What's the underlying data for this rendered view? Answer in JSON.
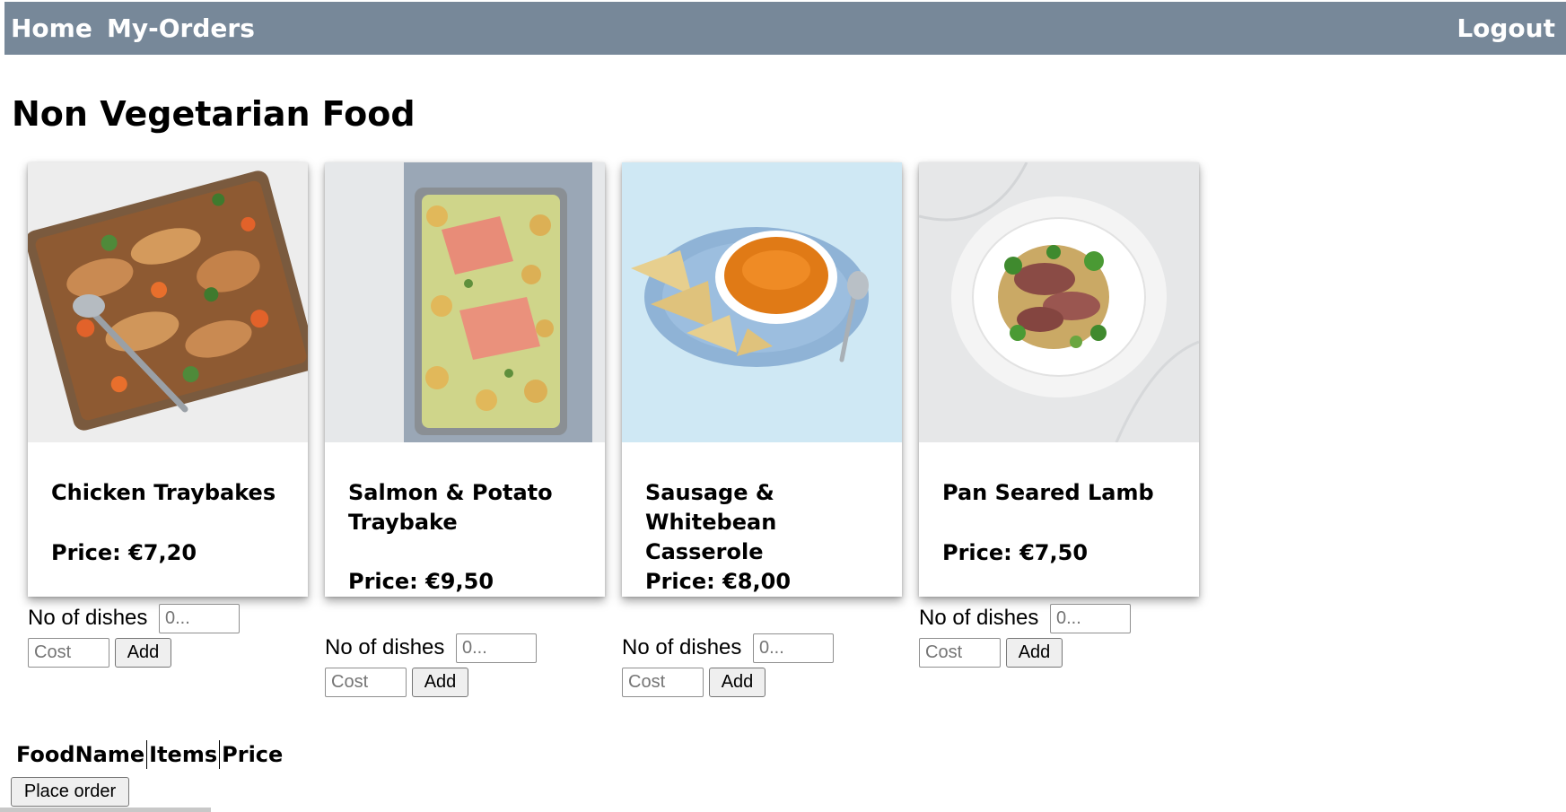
{
  "nav": {
    "home": "Home",
    "orders": "My-Orders",
    "logout": "Logout",
    "bar_color": "#778899"
  },
  "page": {
    "title": "Non Vegetarian Food"
  },
  "items": [
    {
      "name": "Chicken Traybakes",
      "price": "Price: €7,20",
      "image_icon": "chicken-traybake-photo"
    },
    {
      "name": "Salmon & Potato Traybake",
      "price": "Price: €9,50",
      "image_icon": "salmon-traybake-photo"
    },
    {
      "name": "Sausage & Whitebean Casserole",
      "price": "Price: €8,00",
      "image_icon": "soup-bowl-photo"
    },
    {
      "name": "Pan Seared Lamb",
      "price": "Price: €7,50",
      "image_icon": "lamb-plate-photo"
    }
  ],
  "order_form": {
    "dishes_label": "No of dishes",
    "dishes_placeholder": "0...",
    "cost_placeholder": "Cost",
    "add_label": "Add"
  },
  "order_table": {
    "headers": [
      "FoodName",
      "Items",
      "Price"
    ]
  },
  "place_order_label": "Place order"
}
